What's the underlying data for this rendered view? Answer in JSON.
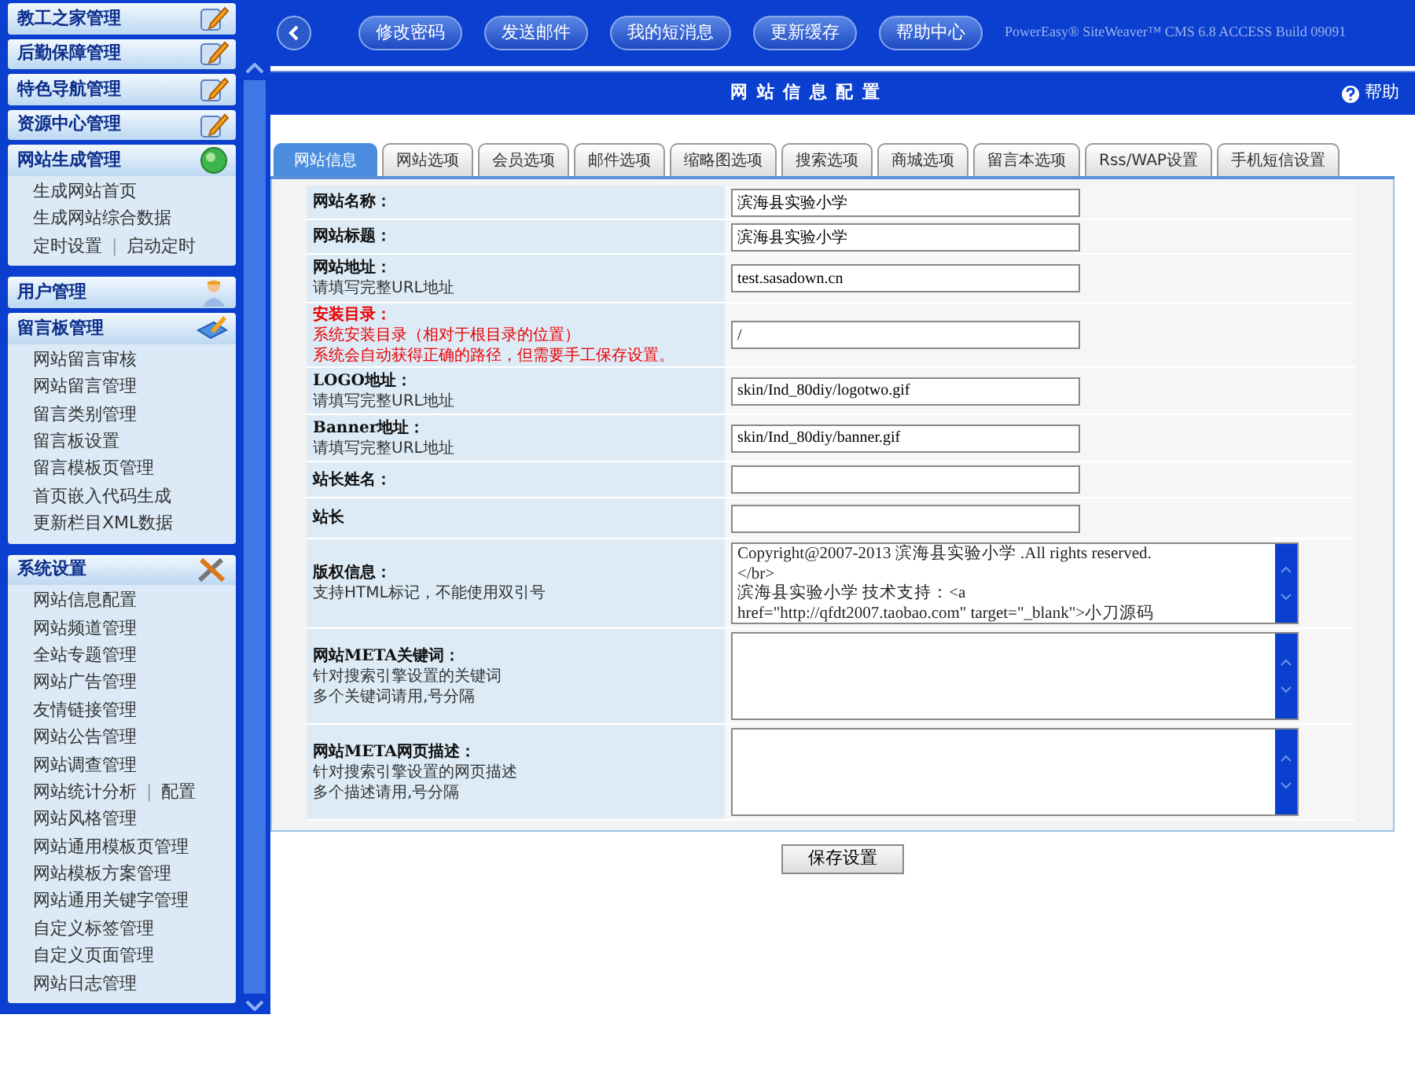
{
  "sidebar": {
    "separator": "|",
    "sections": [
      {
        "title": "教工之家管理",
        "expanded": false
      },
      {
        "title": "后勤保障管理",
        "expanded": false
      },
      {
        "title": "特色导航管理",
        "expanded": false
      },
      {
        "title": "资源中心管理",
        "expanded": false
      },
      {
        "title": "网站生成管理",
        "expanded": true,
        "items": [
          {
            "links": [
              "生成网站首页"
            ]
          },
          {
            "links": [
              "生成网站综合数据"
            ]
          },
          {
            "links": [
              "定时设置",
              "启动定时"
            ]
          }
        ]
      },
      {
        "title": "用户管理",
        "expanded": false
      },
      {
        "title": "留言板管理",
        "expanded": true,
        "items": [
          {
            "links": [
              "网站留言审核"
            ]
          },
          {
            "links": [
              "网站留言管理"
            ]
          },
          {
            "links": [
              "留言类别管理"
            ]
          },
          {
            "links": [
              "留言板设置"
            ]
          },
          {
            "links": [
              "留言模板页管理"
            ]
          },
          {
            "links": [
              "首页嵌入代码生成"
            ]
          },
          {
            "links": [
              "更新栏目XML数据"
            ]
          }
        ]
      },
      {
        "title": "系统设置",
        "expanded": true,
        "items": [
          {
            "links": [
              "网站信息配置"
            ]
          },
          {
            "links": [
              "网站频道管理"
            ]
          },
          {
            "links": [
              "全站专题管理"
            ]
          },
          {
            "links": [
              "网站广告管理"
            ]
          },
          {
            "links": [
              "友情链接管理"
            ]
          },
          {
            "links": [
              "网站公告管理"
            ]
          },
          {
            "links": [
              "网站调查管理"
            ]
          },
          {
            "links": [
              "网站统计分析",
              "配置"
            ]
          },
          {
            "links": [
              "网站风格管理"
            ]
          },
          {
            "links": [
              "网站通用模板页管理"
            ]
          },
          {
            "links": [
              "网站模板方案管理"
            ]
          },
          {
            "links": [
              "网站通用关键字管理"
            ]
          },
          {
            "links": [
              "自定义标签管理"
            ]
          },
          {
            "links": [
              "自定义页面管理"
            ]
          },
          {
            "links": [
              "网站日志管理"
            ]
          }
        ]
      }
    ]
  },
  "toolbar": {
    "buttons": [
      "修改密码",
      "发送邮件",
      "我的短消息",
      "更新缓存",
      "帮助中心"
    ],
    "version": "PowerEasy® SiteWeaver™ CMS 6.8 ACCESS Build 09091"
  },
  "panel": {
    "title": "网 站 信 息 配 置",
    "help": "帮助"
  },
  "tabs": [
    {
      "label": "网站信息",
      "selected": true
    },
    {
      "label": "网站选项",
      "selected": false
    },
    {
      "label": "会员选项",
      "selected": false
    },
    {
      "label": "邮件选项",
      "selected": false
    },
    {
      "label": "缩略图选项",
      "selected": false
    },
    {
      "label": "搜索选项",
      "selected": false
    },
    {
      "label": "商城选项",
      "selected": false
    },
    {
      "label": "留言本选项",
      "selected": false
    },
    {
      "label": "Rss/WAP设置",
      "selected": false
    },
    {
      "label": "手机短信设置",
      "selected": false
    }
  ],
  "form": [
    {
      "kind": "input",
      "label": "网站名称：",
      "warning": false,
      "value": "滨海县实验小学"
    },
    {
      "kind": "input",
      "label": "网站标题：",
      "warning": false,
      "value": "滨海县实验小学"
    },
    {
      "kind": "input",
      "label": "网站地址：",
      "warning": false,
      "notes": [
        "请填写完整URL地址"
      ],
      "value": "test.sasadown.cn"
    },
    {
      "kind": "input",
      "label": "安装目录：",
      "warning": true,
      "notes": [
        "系统安装目录（相对于根目录的位置）",
        "系统会自动获得正确的路径，但需要手工保存设置。"
      ],
      "value": "/"
    },
    {
      "kind": "input",
      "label": "LOGO地址：",
      "warning": false,
      "notes": [
        "请填写完整URL地址"
      ],
      "value": "skin/Ind_80diy/logotwo.gif"
    },
    {
      "kind": "input",
      "label": "Banner地址：",
      "warning": false,
      "notes": [
        "请填写完整URL地址"
      ],
      "value": "skin/Ind_80diy/banner.gif"
    },
    {
      "kind": "input",
      "label": "站长姓名：",
      "warning": false
    },
    {
      "kind": "input",
      "label": "站长",
      "warning": false
    },
    {
      "kind": "textarea",
      "label": "版权信息：",
      "warning": false,
      "notes": [
        "支持HTML标记，不能使用双引号"
      ],
      "value": "Copyright@2007-2013 滨海县实验小学 .All rights reserved.\n</br>\n滨海县实验小学 技术支持：<a\nhref=\"http://qfdt2007.taobao.com\" target=\"_blank\">小刀源码"
    },
    {
      "kind": "textarea",
      "label": "网站META关键词：",
      "warning": false,
      "notes": [
        "针对搜索引擎设置的关键词",
        "多个关键词请用,号分隔"
      ]
    },
    {
      "kind": "textarea",
      "label": "网站META网页描述：",
      "warning": false,
      "notes": [
        "针对搜索引擎设置的网页描述",
        "多个描述请用,号分隔"
      ]
    }
  ],
  "save_button": "保存设置"
}
